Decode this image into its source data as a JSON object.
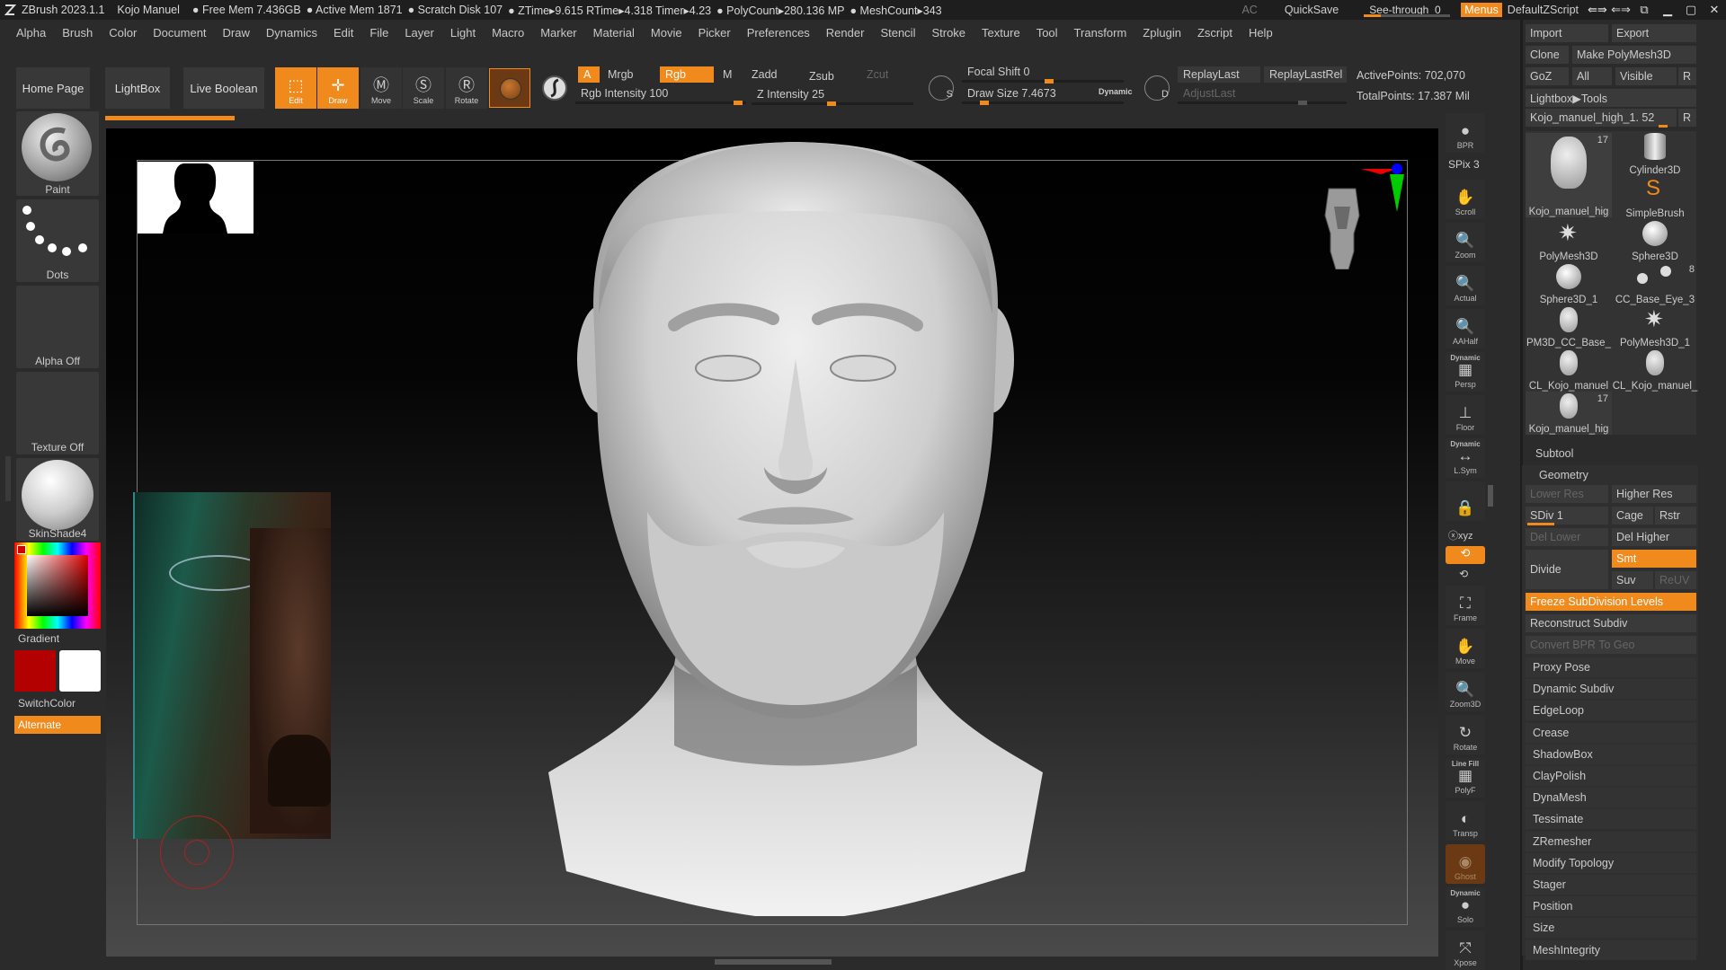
{
  "titlebar": {
    "app": "ZBrush 2023.1.1",
    "project": "Kojo Manuel",
    "stats": [
      "● Free Mem 7.436GB",
      "● Active Mem 1871",
      "● Scratch Disk 107",
      "● ZTime▸9.615 RTime▸4.318 Timer▸4.23",
      "● PolyCount▸280.136 MP",
      "● MeshCount▸343"
    ],
    "ac": "AC",
    "quicksave": "QuickSave",
    "see_through_label": "See-through",
    "see_through_value": "0",
    "menus": "Menus",
    "script": "DefaultZScript",
    "win_icons": [
      "⇚⇛",
      "⇐⇒",
      "⧉",
      "▁",
      "▢",
      "✕"
    ]
  },
  "menubar": [
    "Alpha",
    "Brush",
    "Color",
    "Document",
    "Draw",
    "Dynamics",
    "Edit",
    "File",
    "Layer",
    "Light",
    "Macro",
    "Marker",
    "Material",
    "Movie",
    "Picker",
    "Preferences",
    "Render",
    "Stencil",
    "Stroke",
    "Texture",
    "Tool",
    "Transform",
    "Zplugin",
    "Zscript",
    "Help"
  ],
  "shelf": {
    "home": "Home Page",
    "lightbox": "LightBox",
    "live_boolean": "Live Boolean",
    "tools": [
      {
        "label": "Edit",
        "on": true
      },
      {
        "label": "Draw",
        "on": true
      },
      {
        "label": "Move",
        "on": false
      },
      {
        "label": "Scale",
        "on": false
      },
      {
        "label": "Rotate",
        "on": false
      }
    ],
    "a_label": "A",
    "mrgb": "Mrgb",
    "rgb": "Rgb",
    "m": "M",
    "zadd": "Zadd",
    "zsub": "Zsub",
    "zcut": "Zcut",
    "rgb_intensity": "Rgb Intensity 100",
    "z_intensity": "Z Intensity 25",
    "focal_shift": "Focal Shift 0",
    "draw_size": "Draw Size 7.4673",
    "dynamic": "Dynamic",
    "replay_last": "ReplayLast",
    "replay_last_rel": "ReplayLastRel",
    "adjust_last": "AdjustLast",
    "active_points": "ActivePoints: 702,070",
    "total_points": "TotalPoints: 17.387 Mil"
  },
  "leftbar": {
    "paint": "Paint",
    "dots": "Dots",
    "alpha": "Alpha Off",
    "texture": "Texture Off",
    "material": "SkinShade4",
    "gradient": "Gradient",
    "switchcolor": "SwitchColor",
    "alternate": "Alternate",
    "primary_color": "#b30000",
    "secondary_color": "#ffffff"
  },
  "rightnav": {
    "bpr": "BPR",
    "spix": "SPix 3",
    "scroll": "Scroll",
    "zoom": "Zoom",
    "actual": "Actual",
    "aahalf": "AAHalf",
    "dynamic1": "Dynamic",
    "persp": "Persp",
    "floor": "Floor",
    "dynamic2": "Dynamic",
    "lsym": "L.Sym",
    "xyz": "ⓧxyz",
    "frame": "Frame",
    "move": "Move",
    "zoom3d": "Zoom3D",
    "rotate": "Rotate",
    "linefill": "Line Fill",
    "polyf": "PolyF",
    "transp": "Transp",
    "ghost": "Ghost",
    "dynamic3": "Dynamic",
    "solo": "Solo",
    "xpose": "Xpose"
  },
  "rightpanel": {
    "import": "Import",
    "export": "Export",
    "clone": "Clone",
    "make_polymesh": "Make PolyMesh3D",
    "goz": "GoZ",
    "all": "All",
    "visible": "Visible",
    "r": "R",
    "lightbox_tools": "Lightbox▶Tools",
    "current_tool": "Kojo_manuel_high_1. 52",
    "r2": "R",
    "tools": [
      {
        "label": "Kojo_manuel_hig",
        "count": "17"
      },
      {
        "label": "Cylinder3D",
        "count": ""
      },
      {
        "label": "",
        "count": ""
      },
      {
        "label": "SimpleBrush",
        "count": ""
      },
      {
        "label": "PolyMesh3D",
        "count": ""
      },
      {
        "label": "Sphere3D",
        "count": ""
      },
      {
        "label": "Sphere3D_1",
        "count": ""
      },
      {
        "label": "CC_Base_Eye_3",
        "count": "8"
      },
      {
        "label": "PM3D_CC_Base_",
        "count": ""
      },
      {
        "label": "PolyMesh3D_1",
        "count": ""
      },
      {
        "label": "CL_Kojo_manuel",
        "count": ""
      },
      {
        "label": "CL_Kojo_manuel_",
        "count": ""
      },
      {
        "label": "Kojo_manuel_hig",
        "count": "17"
      }
    ],
    "subtool": "Subtool",
    "geometry": "Geometry",
    "lower_res": "Lower Res",
    "higher_res": "Higher Res",
    "sdiv": "SDiv 1",
    "cage": "Cage",
    "rstr": "Rstr",
    "del_lower": "Del Lower",
    "del_higher": "Del Higher",
    "divide": "Divide",
    "smt": "Smt",
    "suv": "Suv",
    "reuv": "ReUV",
    "freeze": "Freeze SubDivision Levels",
    "reconstruct": "Reconstruct Subdiv",
    "convert_bpr": "Convert BPR To Geo",
    "geo_list": [
      "Proxy Pose",
      "Dynamic Subdiv",
      "EdgeLoop",
      "Crease",
      "ShadowBox",
      "ClayPolish",
      "DynaMesh",
      "Tessimate",
      "ZRemesher",
      "Modify Topology",
      "Stager",
      "Position",
      "Size",
      "MeshIntegrity"
    ]
  },
  "colors": {
    "accent": "#f08a1c",
    "bg": "#2b2b2b"
  }
}
